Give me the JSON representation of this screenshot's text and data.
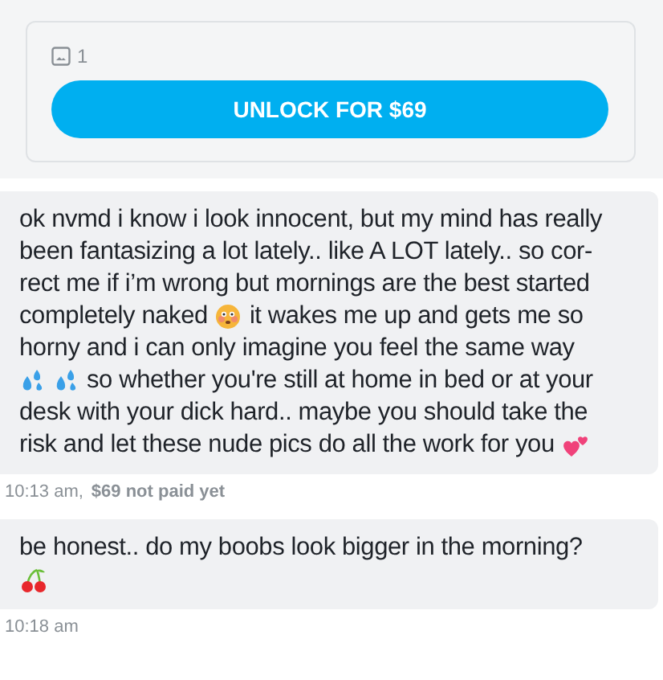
{
  "locked_media": {
    "media_count": "1",
    "unlock_button": "UNLOCK FOR $69"
  },
  "messages": [
    {
      "lines": [
        [
          {
            "kind": "text",
            "text": "ok nvmd i know i look innocent, but my mind has really"
          }
        ],
        [
          {
            "kind": "text",
            "text": "been fantasizing a lot lately.. like A LOT lately.. so cor-"
          }
        ],
        [
          {
            "kind": "text",
            "text": "rect me if i’m wrong but mornings are the best started"
          }
        ],
        [
          {
            "kind": "text",
            "text": "completely naked"
          },
          {
            "kind": "flushed"
          },
          {
            "kind": "text",
            "text": "it wakes me up and gets me so"
          }
        ],
        [
          {
            "kind": "text",
            "text": "horny and i can only imagine you feel the same way"
          }
        ],
        [
          {
            "kind": "sweat"
          },
          {
            "kind": "sweat"
          },
          {
            "kind": "text",
            "text": "so whether you're still at home in bed or at your"
          }
        ],
        [
          {
            "kind": "text",
            "text": "desk with your dick hard.. maybe you should take the"
          }
        ],
        [
          {
            "kind": "text",
            "text": "risk and let these nude pics do all the work for you"
          },
          {
            "kind": "hearts"
          }
        ]
      ],
      "time": "10:13 am,",
      "payment_status": "$69 not paid yet"
    },
    {
      "lines": [
        [
          {
            "kind": "text",
            "text": "be honest.. do my boobs look bigger in the morning?"
          }
        ],
        [
          {
            "kind": "cherries"
          }
        ]
      ],
      "time": "10:18 am"
    }
  ]
}
